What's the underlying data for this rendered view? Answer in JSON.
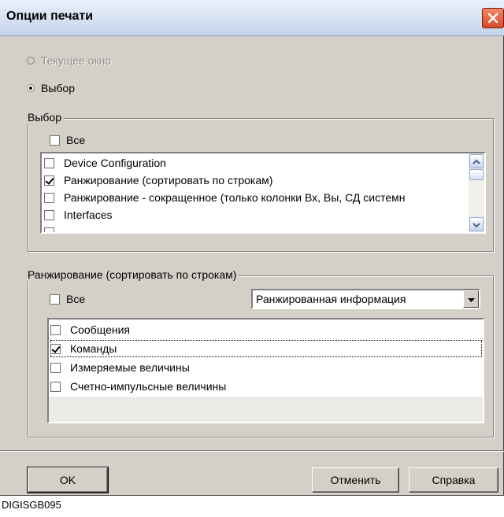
{
  "window": {
    "title": "Опции печати"
  },
  "radios": {
    "current_window": {
      "label": "Текущее окно",
      "disabled": true,
      "checked": false
    },
    "selection": {
      "label": "Выбор",
      "checked": true
    }
  },
  "selection_group": {
    "title": "Выбор",
    "all_label": "Все",
    "items": [
      {
        "label": "Device Configuration",
        "checked": false
      },
      {
        "label": "Ранжирование (сортировать по строкам)",
        "checked": true
      },
      {
        "label": "Ранжирование - сокращенное (только колонки Вх, Вы, СД системн",
        "checked": false
      },
      {
        "label": "Interfaces",
        "checked": false
      },
      {
        "label": "",
        "checked": false
      }
    ]
  },
  "ranking_group": {
    "title": "Ранжирование (сортировать по строкам)",
    "all_label": "Все",
    "combo_value": "Ранжированная информация",
    "items": [
      {
        "label": "Сообщения",
        "checked": false
      },
      {
        "label": "Команды",
        "checked": true,
        "focused": true
      },
      {
        "label": "Измеряемые величины",
        "checked": false
      },
      {
        "label": "Счетно-импульсные величины",
        "checked": false
      }
    ]
  },
  "buttons": {
    "ok": "OK",
    "cancel": "Отменить",
    "help": "Справка"
  },
  "caption": "DIGISGB095",
  "colors": {
    "dialog_bg": "#d4d0c8",
    "title_gradient_top": "#eaf1fb",
    "close_button": "#d9482a"
  },
  "icons": {
    "close": "close-icon",
    "scroll_up": "chevron-up-icon",
    "scroll_down": "chevron-down-icon",
    "combo": "dropdown-arrow-icon"
  }
}
